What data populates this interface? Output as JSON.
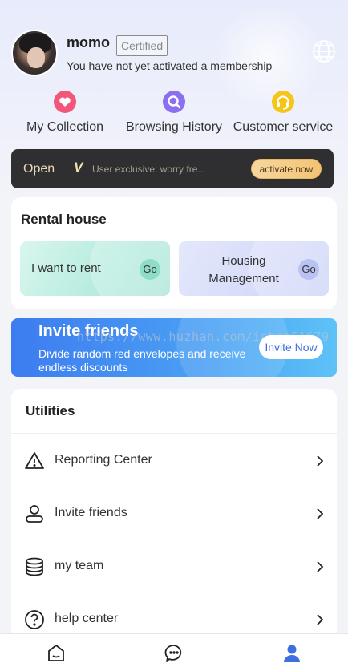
{
  "profile": {
    "username": "momo",
    "badge": "Certified",
    "membership_status": "You have not yet activated a membership"
  },
  "quick_links": [
    {
      "label": "My Collection",
      "icon": "heart-icon",
      "color": "#f2567a"
    },
    {
      "label": "Browsing History",
      "icon": "search-icon",
      "color": "#8a6ff0"
    },
    {
      "label": "Customer service",
      "icon": "headset-icon",
      "color": "#f5c518"
    }
  ],
  "membership_bar": {
    "open_label": "Open",
    "vip_mark": "V",
    "promo_text": "User exclusive: worry fre...",
    "button_label": "activate now"
  },
  "rental": {
    "title": "Rental house",
    "tiles": [
      {
        "label": "I want to rent",
        "go": "Go"
      },
      {
        "label": "Housing Management",
        "go": "Go"
      }
    ]
  },
  "invite_banner": {
    "title": "Invite friends",
    "subtitle": "Divide random red envelopes and receive endless discounts",
    "button_label": "Invite Now",
    "watermark": "https://www.huzhan.com/ishop51679"
  },
  "utilities": {
    "title": "Utilities",
    "items": [
      {
        "label": "Reporting Center",
        "icon": "warning-icon"
      },
      {
        "label": "Invite friends",
        "icon": "user-icon"
      },
      {
        "label": "my team",
        "icon": "database-icon"
      },
      {
        "label": "help center",
        "icon": "help-icon"
      }
    ]
  },
  "bottom_nav": [
    {
      "name": "home",
      "icon": "home-icon",
      "active": false
    },
    {
      "name": "messages",
      "icon": "chat-icon",
      "active": false
    },
    {
      "name": "profile",
      "icon": "person-icon",
      "active": true,
      "color": "#3d6fe0"
    }
  ]
}
